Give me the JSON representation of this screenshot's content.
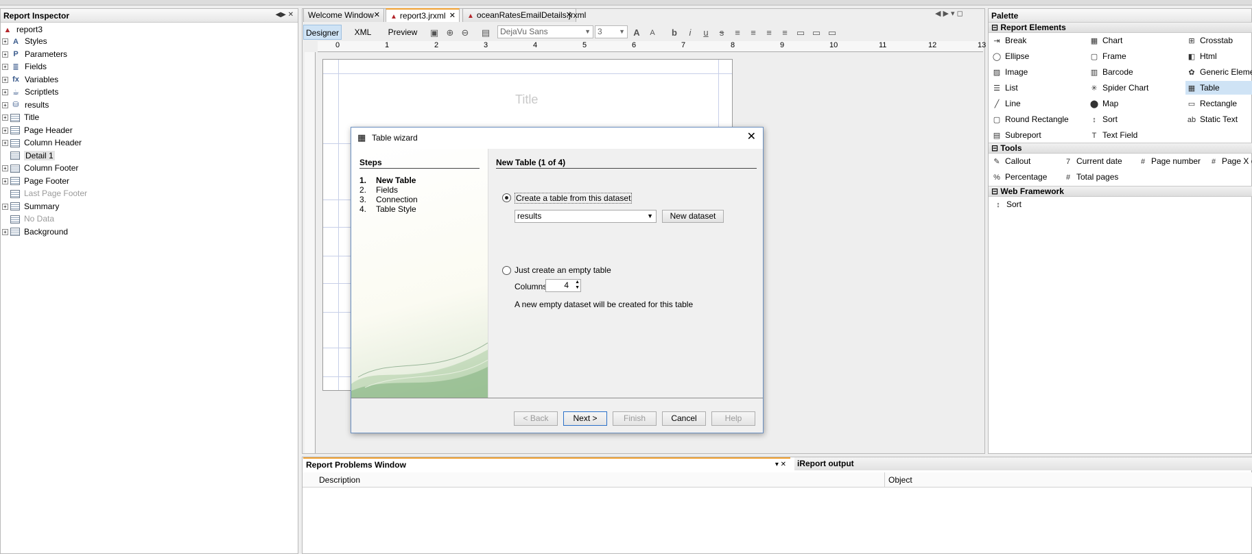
{
  "inspector": {
    "title": "Report Inspector",
    "root": "report3",
    "items": [
      {
        "label": "Styles",
        "expandable": true,
        "dim": false,
        "icon": "styles-icon"
      },
      {
        "label": "Parameters",
        "expandable": true,
        "dim": false,
        "icon": "parameters-icon"
      },
      {
        "label": "Fields",
        "expandable": true,
        "dim": false,
        "icon": "fields-icon"
      },
      {
        "label": "Variables",
        "expandable": true,
        "dim": false,
        "icon": "variables-icon"
      },
      {
        "label": "Scriptlets",
        "expandable": true,
        "dim": false,
        "icon": "scriptlets-icon"
      },
      {
        "label": "results",
        "expandable": true,
        "dim": false,
        "icon": "dataset-icon"
      },
      {
        "label": "Title",
        "expandable": true,
        "dim": false,
        "icon": "band-icon"
      },
      {
        "label": "Page Header",
        "expandable": true,
        "dim": false,
        "icon": "band-icon"
      },
      {
        "label": "Column Header",
        "expandable": true,
        "dim": false,
        "icon": "band-icon"
      },
      {
        "label": "Detail 1",
        "expandable": false,
        "dim": false,
        "icon": "band-icon"
      },
      {
        "label": "Column Footer",
        "expandable": true,
        "dim": false,
        "icon": "band-icon"
      },
      {
        "label": "Page Footer",
        "expandable": true,
        "dim": false,
        "icon": "band-icon"
      },
      {
        "label": "Last Page Footer",
        "expandable": false,
        "dim": true,
        "icon": "band-icon"
      },
      {
        "label": "Summary",
        "expandable": true,
        "dim": false,
        "icon": "band-icon"
      },
      {
        "label": "No Data",
        "expandable": false,
        "dim": true,
        "icon": "band-icon"
      },
      {
        "label": "Background",
        "expandable": true,
        "dim": false,
        "icon": "band-icon"
      }
    ]
  },
  "tabs": [
    {
      "label": "Welcome Window",
      "active": false
    },
    {
      "label": "report3.jrxml",
      "active": true
    },
    {
      "label": "oceanRatesEmailDetails.jrxml",
      "active": false
    }
  ],
  "views": {
    "designer": "Designer",
    "xml": "XML",
    "preview": "Preview"
  },
  "toolbar": {
    "font": "DejaVu Sans",
    "size": "3"
  },
  "ruler": [
    "0",
    "1",
    "2",
    "3",
    "4",
    "5",
    "6",
    "7",
    "8",
    "9",
    "10",
    "11",
    "12",
    "13"
  ],
  "canvas": {
    "title_placeholder": "Title"
  },
  "palette": {
    "title": "Palette",
    "sections": {
      "report_elements": "Report Elements",
      "tools": "Tools",
      "web_framework": "Web Framework"
    },
    "report_elements": [
      [
        "Break",
        "Chart",
        "Crosstab"
      ],
      [
        "Ellipse",
        "Frame",
        "Html"
      ],
      [
        "Image",
        "Barcode",
        "Generic Element"
      ],
      [
        "List",
        "Spider Chart",
        "Table"
      ],
      [
        "Line",
        "Map",
        "Rectangle"
      ],
      [
        "Round Rectangle",
        "Sort",
        "Static Text"
      ],
      [
        "Subreport",
        "Text Field",
        ""
      ]
    ],
    "tools": [
      [
        "Callout",
        "Current date",
        "Page number",
        "Page X of"
      ],
      [
        "Percentage",
        "Total pages",
        "",
        ""
      ]
    ],
    "web": [
      "Sort"
    ]
  },
  "bottom": {
    "problems_title": "Report Problems Window",
    "output_title": "iReport output",
    "col_description": "Description",
    "col_object": "Object"
  },
  "dialog": {
    "title": "Table wizard",
    "steps_header": "Steps",
    "steps": [
      {
        "num": "1.",
        "label": "New Table",
        "current": true
      },
      {
        "num": "2.",
        "label": "Fields",
        "current": false
      },
      {
        "num": "3.",
        "label": "Connection",
        "current": false
      },
      {
        "num": "4.",
        "label": "Table Style",
        "current": false
      }
    ],
    "heading": "New Table (1 of 4)",
    "option_dataset": "Create a table from this dataset",
    "dataset_value": "results",
    "new_dataset": "New dataset",
    "option_empty": "Just create an empty table",
    "columns_label": "Columns",
    "columns_value": "4",
    "empty_note": "A new empty dataset will be created for this table",
    "buttons": {
      "back": "< Back",
      "next": "Next >",
      "finish": "Finish",
      "cancel": "Cancel",
      "help": "Help"
    }
  }
}
